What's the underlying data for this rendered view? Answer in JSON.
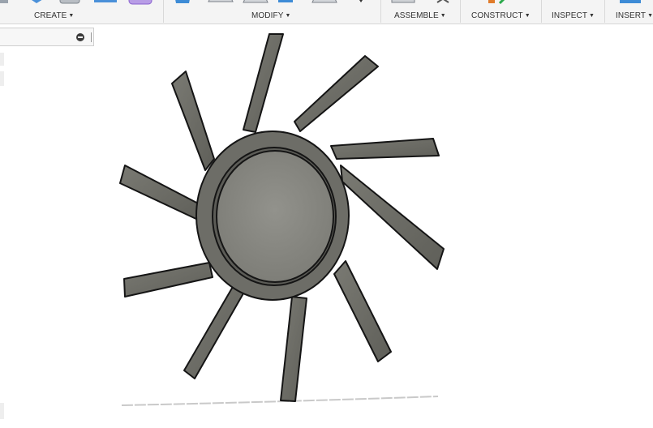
{
  "toolbar": {
    "groups": [
      {
        "label": "CREATE",
        "caret": "▼"
      },
      {
        "label": "MODIFY",
        "caret": "▼"
      },
      {
        "label": "ASSEMBLE",
        "caret": "▼"
      },
      {
        "label": "CONSTRUCT",
        "caret": "▼"
      },
      {
        "label": "INSPECT",
        "caret": "▼"
      },
      {
        "label": "INSERT",
        "caret": "▼"
      }
    ]
  },
  "colors": {
    "toolbar_bg": "#f4f4f4",
    "blade_fill": "#6f6f68",
    "hub_fill": "#858580",
    "outline": "#1a1a1a",
    "accent_blue": "#2f8fdc",
    "accent_purple": "#9b6fd6"
  },
  "icons": [
    "create-tool-icon",
    "modify-tool-icon",
    "assemble-tool-icon",
    "construct-tool-icon",
    "insert-tool-icon",
    "collapse-icon"
  ]
}
